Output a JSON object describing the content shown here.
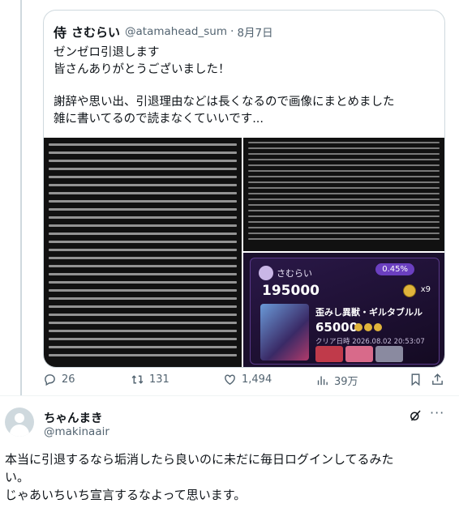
{
  "quote": {
    "logo_char": "侍",
    "name": "さむらい",
    "handle": "@atamahead_sum",
    "date": "8月7日",
    "lines": [
      "ゼンゼロ引退します",
      "皆さんありがとうございました！",
      "",
      "謝辞や思い出、引退理由などは長くなるので画像にまとめました",
      "雑に書いてるので読まなくていいです..."
    ],
    "game": {
      "player": "さむらい",
      "rate": "0.45%",
      "score": "195000",
      "multiplier": "x9",
      "boss": "歪みし異獣・ギルタブルル",
      "boss_score": "65000",
      "clear_date": "クリア日時 2026.08.02 20:53:07"
    }
  },
  "actions": {
    "replies": "26",
    "retweets": "131",
    "likes": "1,494",
    "views": "39万"
  },
  "reply": {
    "name": "ちゃんまき",
    "handle": "@makinaair",
    "more": "···",
    "lines": [
      "本当に引退するなら垢消したら良いのに未だに毎日ログインしてるみた",
      "い。",
      "じゃあいちいち宣言するなよって思います。"
    ]
  },
  "colors": {
    "muted": "#536471",
    "border": "#cfd9de",
    "text": "#0f1419"
  },
  "icons": [
    "reply-icon",
    "retweet-icon",
    "like-icon",
    "views-icon",
    "bookmark-icon",
    "share-icon",
    "grok-icon",
    "more-icon"
  ]
}
